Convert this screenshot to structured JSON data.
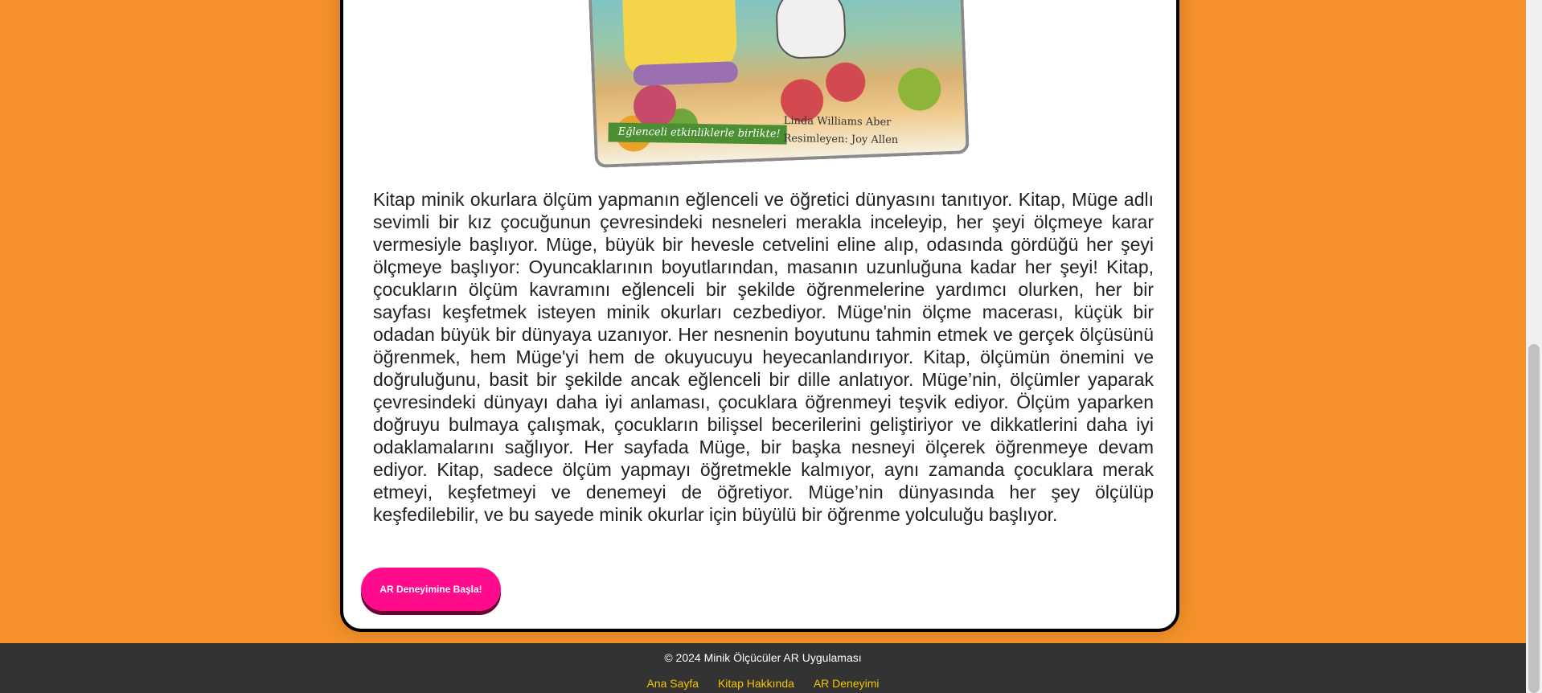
{
  "book": {
    "cover_ribbon": "Eğlenceli etkinliklerle birlikte!",
    "cover_author": "Linda Williams Aber",
    "cover_illustrator": "Resimleyen: Joy Allen",
    "description": "Kitap minik okurlara ölçüm yapmanın eğlenceli ve öğretici dünyasını tanıtıyor. Kitap, Müge adlı sevimli bir kız çocuğunun çevresindeki nesneleri merakla inceleyip, her şeyi ölçmeye karar vermesiyle başlıyor. Müge, büyük bir hevesle cetvelini eline alıp, odasında gördüğü her şeyi ölçmeye başlıyor: Oyuncaklarının boyutlarından, masanın uzunluğuna kadar her şeyi! Kitap, çocukların ölçüm kavramını eğlenceli bir şekilde öğrenmelerine yardımcı olurken, her bir sayfası keşfetmek isteyen minik okurları cezbediyor. Müge'nin ölçme macerası, küçük bir odadan büyük bir dünyaya uzanıyor. Her nesnenin boyutunu tahmin etmek ve gerçek ölçüsünü öğrenmek, hem Müge'yi hem de okuyucuyu heyecanlandırıyor. Kitap, ölçümün önemini ve doğruluğunu, basit bir şekilde ancak eğlenceli bir dille anlatıyor. Müge’nin, ölçümler yaparak çevresindeki dünyayı daha iyi anlaması, çocuklara öğrenmeyi teşvik ediyor. Ölçüm yaparken doğruyu bulmaya çalışmak, çocukların bilişsel becerilerini geliştiriyor ve dikkatlerini daha iyi odaklamalarını sağlıyor. Her sayfada Müge, bir başka nesneyi ölçerek öğrenmeye devam ediyor. Kitap, sadece ölçüm yapmayı öğretmekle kalmıyor, aynı zamanda çocuklara merak etmeyi, keşfetmeyi ve denemeyi de öğretiyor. Müge’nin dünyasında her şey ölçülüp keşfedilebilir, ve bu sayede minik okurlar için büyülü bir öğrenme yolculuğu başlıyor."
  },
  "ar_button": {
    "label": "AR Deneyimine Başla!"
  },
  "footer": {
    "copyright": "© 2024 Minik Ölçücüler AR Uygulaması",
    "links": [
      "Ana Sayfa",
      "Kitap Hakkında",
      "AR Deneyimi"
    ]
  },
  "colors": {
    "background": "#f7922a",
    "button": "#ff0b8c",
    "footer": "#333333",
    "footer_link": "#f5c400"
  }
}
